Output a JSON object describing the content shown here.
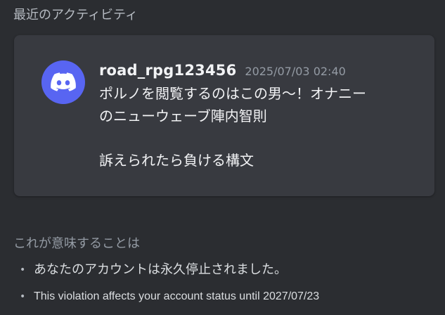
{
  "section": {
    "title": "最近のアクティビティ"
  },
  "message": {
    "username": "road_rpg123456",
    "timestamp": "2025/07/03 02:40",
    "lines": [
      "ポルノを閲覧するのはこの男〜！オナニー",
      "のニューウェーブ陣内智則",
      "訴えられたら負ける構文"
    ],
    "avatar_icon": "discord-logo-icon",
    "avatar_color": "#5865f2"
  },
  "meaning": {
    "title": "これが意味することは",
    "bullets": [
      "あなたのアカウントは永久停止されました。",
      "This violation affects your account status until 2027/07/23"
    ]
  },
  "colors": {
    "background": "#2b2d31",
    "card": "#383a40"
  }
}
